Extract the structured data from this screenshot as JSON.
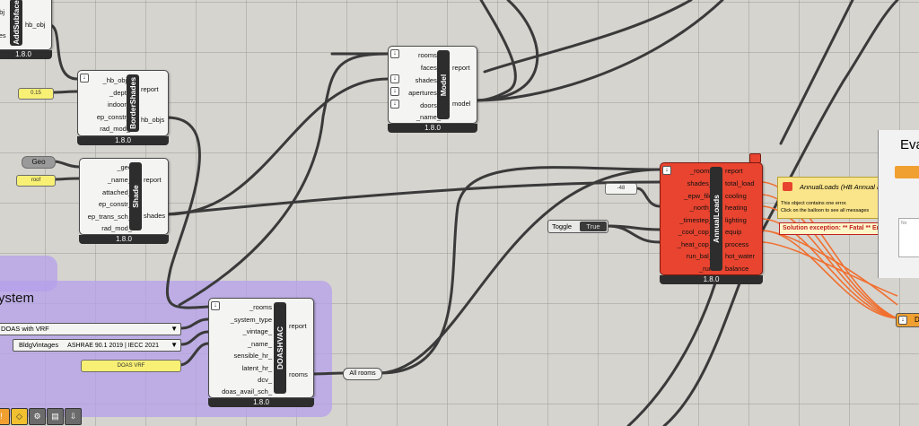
{
  "components": {
    "addsubface": {
      "title": "AddSubface",
      "inputs": [
        "obj",
        "ces"
      ],
      "output": "hb_obj",
      "version": "1.8.0"
    },
    "bordershades": {
      "title": "BorderShades",
      "inputs": [
        "_hb_objs",
        "_depth",
        "indoor_",
        "ep_constr_",
        "rad_mod_"
      ],
      "outputs": [
        "report",
        "hb_objs"
      ],
      "version": "1.8.0"
    },
    "shade": {
      "title": "Shade",
      "inputs": [
        "_geo",
        "_name_",
        "attached_",
        "ep_constr_",
        "ep_trans_sch_",
        "rad_mod_"
      ],
      "outputs": [
        "report",
        "shades"
      ],
      "version": "1.8.0"
    },
    "model": {
      "title": "Model",
      "inputs": [
        "rooms_",
        "faces_",
        "shades_",
        "apertures_",
        "doors_",
        "_name_"
      ],
      "outputs": [
        "report",
        "model"
      ],
      "version": "1.8.0"
    },
    "annualloads": {
      "title": "AnnualLoads",
      "inputs": [
        "_rooms",
        "shades_",
        "_epw_file",
        "_north_",
        "_timestep_",
        "_cool_cop_",
        "_heat_cop_",
        "run_bal_",
        "_run"
      ],
      "outputs": [
        "report",
        "total_load",
        "cooling",
        "heating",
        "lighting",
        "equip",
        "process",
        "hot_water",
        "balance"
      ],
      "version": "1.8.0"
    },
    "doashvac": {
      "title": "DOASHVAC",
      "inputs": [
        "_rooms",
        "_system_type",
        "_vintage_",
        "_name_",
        "sensible_hr_",
        "latent_hr_",
        "dcv_",
        "doas_avail_sch_"
      ],
      "outputs": [
        "report",
        "rooms"
      ],
      "version": "1.8.0"
    }
  },
  "panels": {
    "depth_value": "0.15",
    "shade_name": "roof",
    "north_value": "-48",
    "doas_name": "DOAS VRF"
  },
  "params": {
    "geo_label": "Geo"
  },
  "toggle": {
    "label": "Toggle",
    "value": "True"
  },
  "relay": {
    "label": "All rooms"
  },
  "group": {
    "title": "ystem"
  },
  "dropdowns": {
    "system_type": "DOAS with VRF",
    "vintage_prefix": "BldgVintages",
    "vintage_value": "ASHRAE 90.1 2019 | IECC 2021"
  },
  "balloon": {
    "title": "AnnualLoads (HB Annual Loads)",
    "line1": "This object contains one error.",
    "line2": "Click on the balloon to see all messages",
    "exception": "Solution exception:  **  Fatal  ** Errors occu"
  },
  "side_panel": {
    "title": "Eva",
    "note": "No"
  },
  "bottom_right_label": "D",
  "colors": {
    "error_red": "#e8442f",
    "wire": "#3a3a3a",
    "group_purple": "#b4a0eb",
    "panel_yellow": "#f7f074",
    "warning_orange": "#f07030"
  }
}
